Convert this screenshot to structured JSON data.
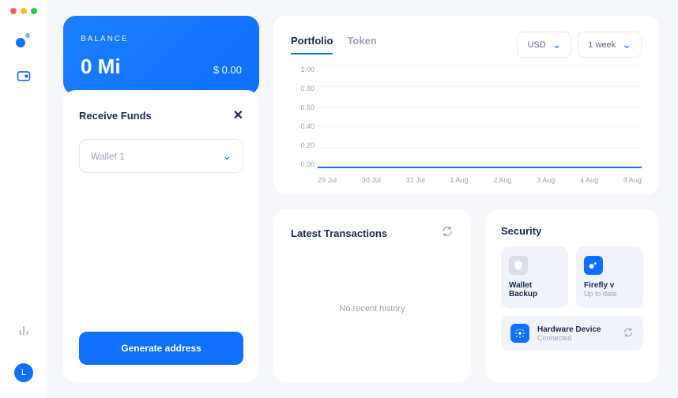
{
  "sidebar": {
    "avatar_initial": "L"
  },
  "balance": {
    "label": "BALANCE",
    "amount": "0 Mi",
    "fiat": "$ 0.00"
  },
  "receive": {
    "title": "Receive Funds",
    "wallet_selected": "Wallet 1",
    "generate_label": "Generate address"
  },
  "chart": {
    "tabs": {
      "portfolio": "Portfolio",
      "token": "Token"
    },
    "currency": "USD",
    "range": "1 week"
  },
  "chart_data": {
    "type": "line",
    "title": "",
    "xlabel": "",
    "ylabel": "",
    "ylim": [
      0,
      1.0
    ],
    "y_ticks": [
      "1.00",
      "0.80",
      "0.60",
      "0.40",
      "0.20",
      "0.00"
    ],
    "categories": [
      "29 Jul",
      "30 Jul",
      "31 Jul",
      "1 Aug",
      "2 Aug",
      "3 Aug",
      "4 Aug",
      "4 Aug"
    ],
    "series": [
      {
        "name": "Portfolio",
        "values": [
          0,
          0,
          0,
          0,
          0,
          0,
          0,
          0
        ]
      }
    ]
  },
  "transactions": {
    "title": "Latest Transactions",
    "empty": "No recent history"
  },
  "security": {
    "title": "Security",
    "backup_label": "Wallet Backup",
    "version_label": "Firefly v",
    "version_sub": "Up to date",
    "hardware_label": "Hardware Device",
    "hardware_sub": "Connected"
  }
}
